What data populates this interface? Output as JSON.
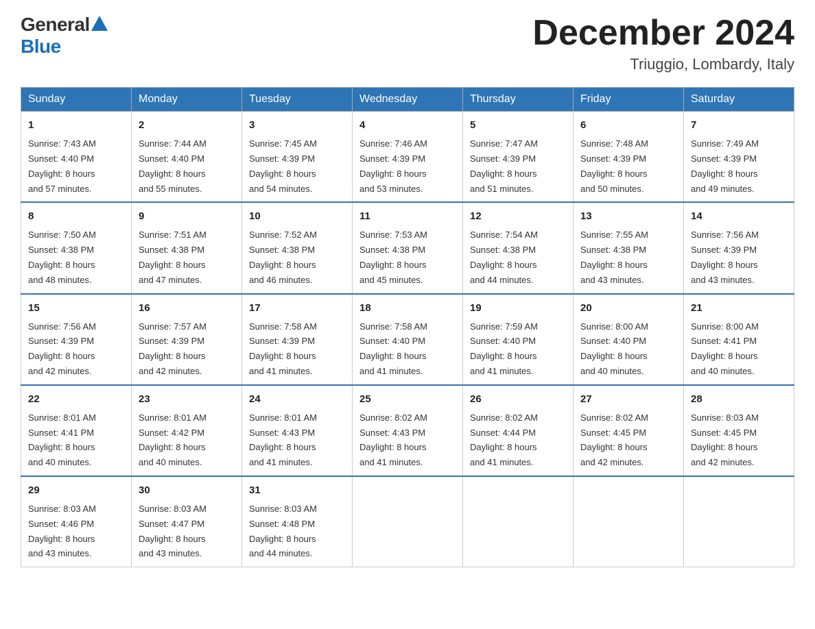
{
  "header": {
    "logo_general": "General",
    "logo_blue": "Blue",
    "month_title": "December 2024",
    "location": "Triuggio, Lombardy, Italy"
  },
  "days_of_week": [
    "Sunday",
    "Monday",
    "Tuesday",
    "Wednesday",
    "Thursday",
    "Friday",
    "Saturday"
  ],
  "weeks": [
    [
      {
        "day": "1",
        "sunrise": "7:43 AM",
        "sunset": "4:40 PM",
        "daylight": "8 hours and 57 minutes."
      },
      {
        "day": "2",
        "sunrise": "7:44 AM",
        "sunset": "4:40 PM",
        "daylight": "8 hours and 55 minutes."
      },
      {
        "day": "3",
        "sunrise": "7:45 AM",
        "sunset": "4:39 PM",
        "daylight": "8 hours and 54 minutes."
      },
      {
        "day": "4",
        "sunrise": "7:46 AM",
        "sunset": "4:39 PM",
        "daylight": "8 hours and 53 minutes."
      },
      {
        "day": "5",
        "sunrise": "7:47 AM",
        "sunset": "4:39 PM",
        "daylight": "8 hours and 51 minutes."
      },
      {
        "day": "6",
        "sunrise": "7:48 AM",
        "sunset": "4:39 PM",
        "daylight": "8 hours and 50 minutes."
      },
      {
        "day": "7",
        "sunrise": "7:49 AM",
        "sunset": "4:39 PM",
        "daylight": "8 hours and 49 minutes."
      }
    ],
    [
      {
        "day": "8",
        "sunrise": "7:50 AM",
        "sunset": "4:38 PM",
        "daylight": "8 hours and 48 minutes."
      },
      {
        "day": "9",
        "sunrise": "7:51 AM",
        "sunset": "4:38 PM",
        "daylight": "8 hours and 47 minutes."
      },
      {
        "day": "10",
        "sunrise": "7:52 AM",
        "sunset": "4:38 PM",
        "daylight": "8 hours and 46 minutes."
      },
      {
        "day": "11",
        "sunrise": "7:53 AM",
        "sunset": "4:38 PM",
        "daylight": "8 hours and 45 minutes."
      },
      {
        "day": "12",
        "sunrise": "7:54 AM",
        "sunset": "4:38 PM",
        "daylight": "8 hours and 44 minutes."
      },
      {
        "day": "13",
        "sunrise": "7:55 AM",
        "sunset": "4:38 PM",
        "daylight": "8 hours and 43 minutes."
      },
      {
        "day": "14",
        "sunrise": "7:56 AM",
        "sunset": "4:39 PM",
        "daylight": "8 hours and 43 minutes."
      }
    ],
    [
      {
        "day": "15",
        "sunrise": "7:56 AM",
        "sunset": "4:39 PM",
        "daylight": "8 hours and 42 minutes."
      },
      {
        "day": "16",
        "sunrise": "7:57 AM",
        "sunset": "4:39 PM",
        "daylight": "8 hours and 42 minutes."
      },
      {
        "day": "17",
        "sunrise": "7:58 AM",
        "sunset": "4:39 PM",
        "daylight": "8 hours and 41 minutes."
      },
      {
        "day": "18",
        "sunrise": "7:58 AM",
        "sunset": "4:40 PM",
        "daylight": "8 hours and 41 minutes."
      },
      {
        "day": "19",
        "sunrise": "7:59 AM",
        "sunset": "4:40 PM",
        "daylight": "8 hours and 41 minutes."
      },
      {
        "day": "20",
        "sunrise": "8:00 AM",
        "sunset": "4:40 PM",
        "daylight": "8 hours and 40 minutes."
      },
      {
        "day": "21",
        "sunrise": "8:00 AM",
        "sunset": "4:41 PM",
        "daylight": "8 hours and 40 minutes."
      }
    ],
    [
      {
        "day": "22",
        "sunrise": "8:01 AM",
        "sunset": "4:41 PM",
        "daylight": "8 hours and 40 minutes."
      },
      {
        "day": "23",
        "sunrise": "8:01 AM",
        "sunset": "4:42 PM",
        "daylight": "8 hours and 40 minutes."
      },
      {
        "day": "24",
        "sunrise": "8:01 AM",
        "sunset": "4:43 PM",
        "daylight": "8 hours and 41 minutes."
      },
      {
        "day": "25",
        "sunrise": "8:02 AM",
        "sunset": "4:43 PM",
        "daylight": "8 hours and 41 minutes."
      },
      {
        "day": "26",
        "sunrise": "8:02 AM",
        "sunset": "4:44 PM",
        "daylight": "8 hours and 41 minutes."
      },
      {
        "day": "27",
        "sunrise": "8:02 AM",
        "sunset": "4:45 PM",
        "daylight": "8 hours and 42 minutes."
      },
      {
        "day": "28",
        "sunrise": "8:03 AM",
        "sunset": "4:45 PM",
        "daylight": "8 hours and 42 minutes."
      }
    ],
    [
      {
        "day": "29",
        "sunrise": "8:03 AM",
        "sunset": "4:46 PM",
        "daylight": "8 hours and 43 minutes."
      },
      {
        "day": "30",
        "sunrise": "8:03 AM",
        "sunset": "4:47 PM",
        "daylight": "8 hours and 43 minutes."
      },
      {
        "day": "31",
        "sunrise": "8:03 AM",
        "sunset": "4:48 PM",
        "daylight": "8 hours and 44 minutes."
      },
      null,
      null,
      null,
      null
    ]
  ],
  "labels": {
    "sunrise": "Sunrise:",
    "sunset": "Sunset:",
    "daylight": "Daylight:"
  }
}
